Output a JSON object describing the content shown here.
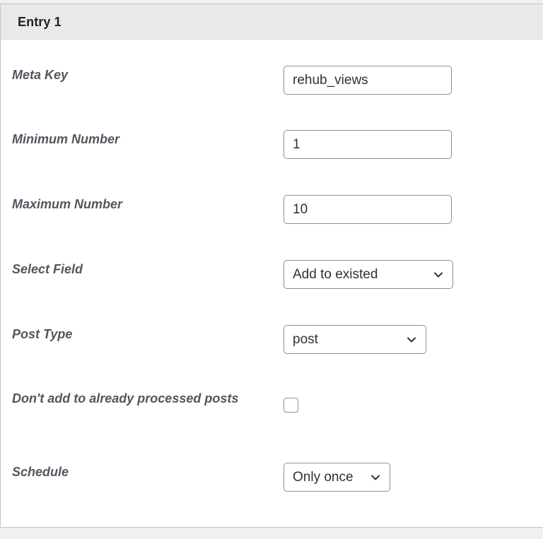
{
  "panel": {
    "title": "Entry 1"
  },
  "fields": {
    "meta_key": {
      "label": "Meta Key",
      "value": "rehub_views"
    },
    "minimum_number": {
      "label": "Minimum Number",
      "value": "1"
    },
    "maximum_number": {
      "label": "Maximum Number",
      "value": "10"
    },
    "select_field": {
      "label": "Select Field",
      "selected": "Add to existed"
    },
    "post_type": {
      "label": "Post Type",
      "selected": "post"
    },
    "dont_add": {
      "label": "Don't add to already processed posts",
      "checked": false
    },
    "schedule": {
      "label": "Schedule",
      "selected": "Only once"
    }
  },
  "icons": {
    "select_arrow": "chevron-down-icon"
  }
}
